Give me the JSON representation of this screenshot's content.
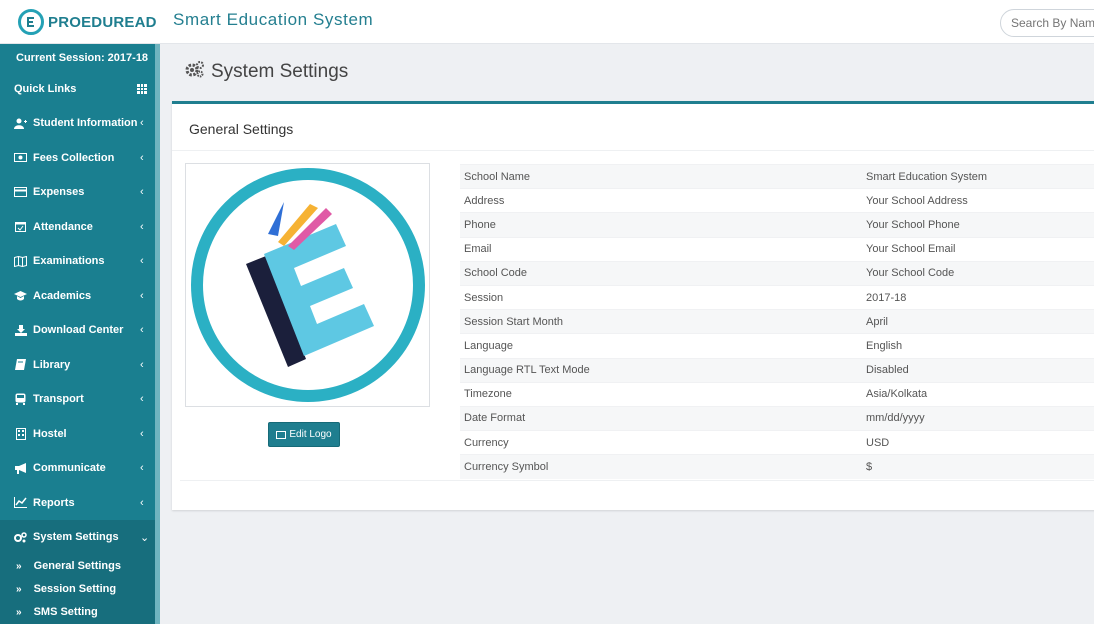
{
  "header": {
    "brand": "PROEDUREAD",
    "app_title": "Smart Education System",
    "search_placeholder": "Search By Name"
  },
  "sidebar": {
    "session": "Current Session: 2017-18",
    "quick_links": "Quick Links",
    "items": [
      {
        "label": "Student Information",
        "icon": "user-plus-icon"
      },
      {
        "label": "Fees Collection",
        "icon": "money-icon"
      },
      {
        "label": "Expenses",
        "icon": "credit-card-icon"
      },
      {
        "label": "Attendance",
        "icon": "calendar-check-icon"
      },
      {
        "label": "Examinations",
        "icon": "map-icon"
      },
      {
        "label": "Academics",
        "icon": "graduation-cap-icon"
      },
      {
        "label": "Download Center",
        "icon": "download-icon"
      },
      {
        "label": "Library",
        "icon": "book-icon"
      },
      {
        "label": "Transport",
        "icon": "bus-icon"
      },
      {
        "label": "Hostel",
        "icon": "building-icon"
      },
      {
        "label": "Communicate",
        "icon": "bullhorn-icon"
      },
      {
        "label": "Reports",
        "icon": "line-chart-icon"
      },
      {
        "label": "System Settings",
        "icon": "gears-icon"
      }
    ],
    "sub_items": [
      "General Settings",
      "Session Setting",
      "SMS Setting"
    ]
  },
  "main": {
    "page_title": "System Settings",
    "panel_title": "General Settings",
    "edit_logo": "Edit Logo",
    "settings": [
      {
        "label": "School Name",
        "value": "Smart Education System"
      },
      {
        "label": "Address",
        "value": "Your School Address"
      },
      {
        "label": "Phone",
        "value": "Your School Phone"
      },
      {
        "label": "Email",
        "value": "Your School Email"
      },
      {
        "label": "School Code",
        "value": "Your School Code"
      },
      {
        "label": "Session",
        "value": "2017-18"
      },
      {
        "label": "Session Start Month",
        "value": "April"
      },
      {
        "label": "Language",
        "value": "English"
      },
      {
        "label": "Language RTL Text Mode",
        "value": "Disabled"
      },
      {
        "label": "Timezone",
        "value": "Asia/Kolkata"
      },
      {
        "label": "Date Format",
        "value": "mm/dd/yyyy"
      },
      {
        "label": "Currency",
        "value": "USD"
      },
      {
        "label": "Currency Symbol",
        "value": "$"
      }
    ]
  },
  "colors": {
    "accent": "#1f7e8f",
    "sidebar": "#1a7f90",
    "logo_ring": "#2bb0c4"
  }
}
